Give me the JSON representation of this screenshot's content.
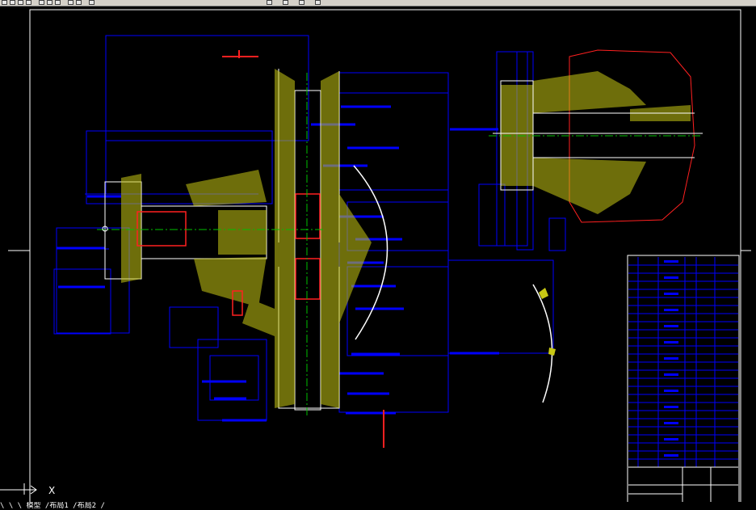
{
  "window": {
    "toolbar_icons": [
      "new-icon",
      "open-icon",
      "save-icon",
      "print-icon",
      "cut-icon",
      "copy-icon",
      "paste-icon",
      "undo-icon",
      "redo-icon",
      "zoom-icon",
      "properties-icon",
      "layer-icon",
      "grid-icon",
      "snap-icon"
    ]
  },
  "drawing": {
    "background": "#000000",
    "outline_color": "#ffffff",
    "dimension_color": "#0000ff",
    "hatch_color": "#c8c814",
    "centerline_color": "#00c000",
    "section_color": "#ff2020"
  },
  "ucs": {
    "x_label": "X"
  },
  "command_line": {
    "text": "\\ \\ \\ 模型 /布局1 /布局2 /"
  }
}
